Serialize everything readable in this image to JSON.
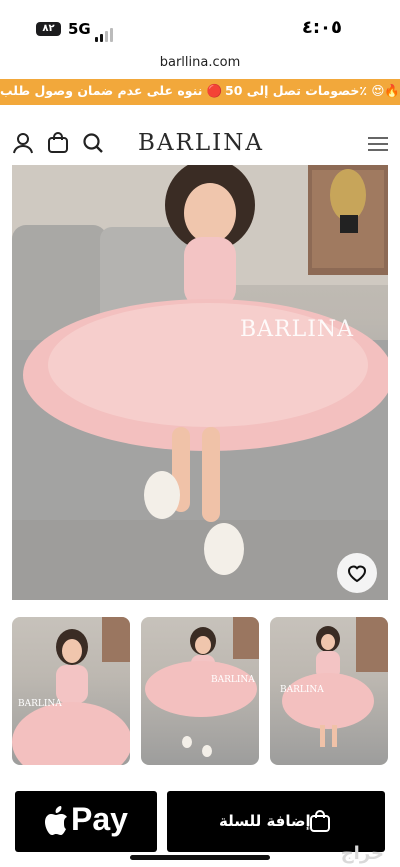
{
  "status_bar": {
    "time": "٤:٠٥",
    "network": "5G",
    "battery": "٨٢"
  },
  "browser": {
    "url": "barllina.com"
  },
  "promo": {
    "text_right": "خصومات تصل إلى 50٪ 😍🔥",
    "text_left": "🔴 ننوه على عدم ضمان وصول طلب"
  },
  "header": {
    "logo": "BARLINA",
    "icons": [
      "account-icon",
      "bag-icon",
      "search-icon",
      "menu-icon"
    ]
  },
  "product": {
    "watermark": "BARLINA",
    "thumbnails": [
      "BARLINA",
      "BARLINA",
      "BARLINA"
    ]
  },
  "actions": {
    "apple_pay_label": "Pay",
    "add_to_cart_label": "إضافة للسلة"
  },
  "footer": {
    "watermark": "حراج"
  },
  "colors": {
    "promo_bg": "#f2a83b",
    "dress_pink": "#f3c0bf",
    "button_bg": "#000000"
  }
}
